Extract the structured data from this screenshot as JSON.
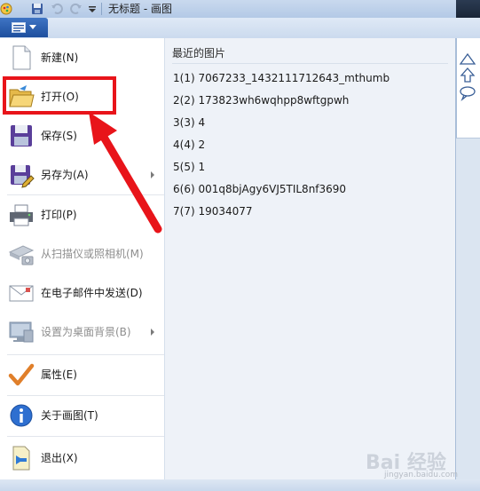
{
  "window": {
    "title": "无标题 - 画图"
  },
  "menu": {
    "items": [
      {
        "label": "新建(N)",
        "icon": "new-file-icon",
        "enabled": true,
        "submenu": false
      },
      {
        "label": "打开(O)",
        "icon": "open-folder-icon",
        "enabled": true,
        "submenu": false
      },
      {
        "label": "保存(S)",
        "icon": "floppy-disk-icon",
        "enabled": true,
        "submenu": false
      },
      {
        "label": "另存为(A)",
        "icon": "save-as-icon",
        "enabled": true,
        "submenu": true
      },
      {
        "label": "打印(P)",
        "icon": "printer-icon",
        "enabled": true,
        "submenu": true
      },
      {
        "label": "从扫描仪或照相机(M)",
        "icon": "scanner-camera-icon",
        "enabled": false,
        "submenu": false
      },
      {
        "label": "在电子邮件中发送(D)",
        "icon": "email-icon",
        "enabled": true,
        "submenu": false
      },
      {
        "label": "设置为桌面背景(B)",
        "icon": "desktop-background-icon",
        "enabled": false,
        "submenu": true
      },
      {
        "label": "属性(E)",
        "icon": "checkmark-icon",
        "enabled": true,
        "submenu": false
      },
      {
        "label": "关于画图(T)",
        "icon": "info-icon",
        "enabled": true,
        "submenu": false
      },
      {
        "label": "退出(X)",
        "icon": "exit-icon",
        "enabled": true,
        "submenu": false
      }
    ]
  },
  "recent": {
    "title": "最近的图片",
    "items": [
      "1(1)  7067233_1432111712643_mthumb",
      "2(2)  173823wh6wqhpp8wftgpwh",
      "3(3)  4",
      "4(4)  2",
      "5(5)  1",
      "6(6)  001q8bjAgy6VJ5TIL8nf3690",
      "7(7)  19034077"
    ]
  },
  "watermark": {
    "text": "Bai 经验",
    "sub": "jingyan.baidu.com"
  },
  "colors": {
    "annotation_red": "#e8141a",
    "menu_button_blue": "#1d4f9e"
  }
}
